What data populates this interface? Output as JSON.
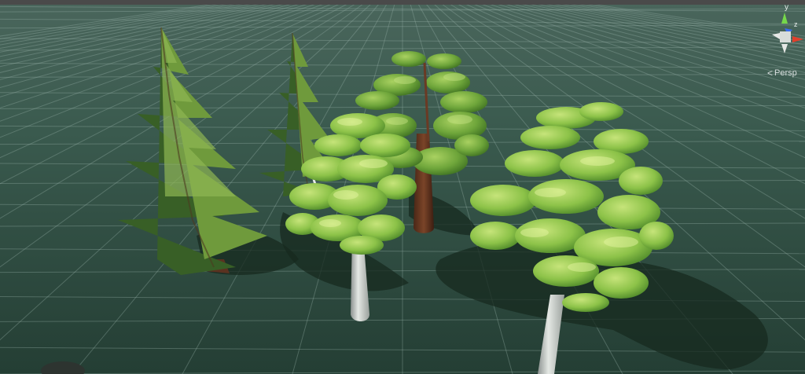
{
  "scene_view": {
    "projection_label": "Persp",
    "gizmo": {
      "y_axis_label": "y",
      "z_axis_label": "z",
      "axis_colors": {
        "x": "#e0402c",
        "y": "#76d84a",
        "z": "#3a6cf0"
      }
    },
    "colors": {
      "sky": "#58625e",
      "ground_near": "#274338",
      "ground_far": "#446158",
      "grid_line": "#8aa49c",
      "pine_dark": "#3d6b2a",
      "pine_light": "#7fa84a",
      "leaf_dark": "#4f8f2a",
      "leaf_light": "#b5dc6a",
      "trunk_birch": "#d2d6d2",
      "trunk_bark": "#6a3a24",
      "shadow": "#16261f"
    },
    "objects": [
      {
        "name": "pine-tree-large",
        "kind": "pine"
      },
      {
        "name": "pine-tree-small",
        "kind": "pine"
      },
      {
        "name": "broadleaf-tree-birch-left",
        "kind": "broadleaf"
      },
      {
        "name": "broadleaf-tree-back",
        "kind": "broadleaf"
      },
      {
        "name": "broadleaf-tree-birch-right",
        "kind": "broadleaf"
      }
    ]
  }
}
